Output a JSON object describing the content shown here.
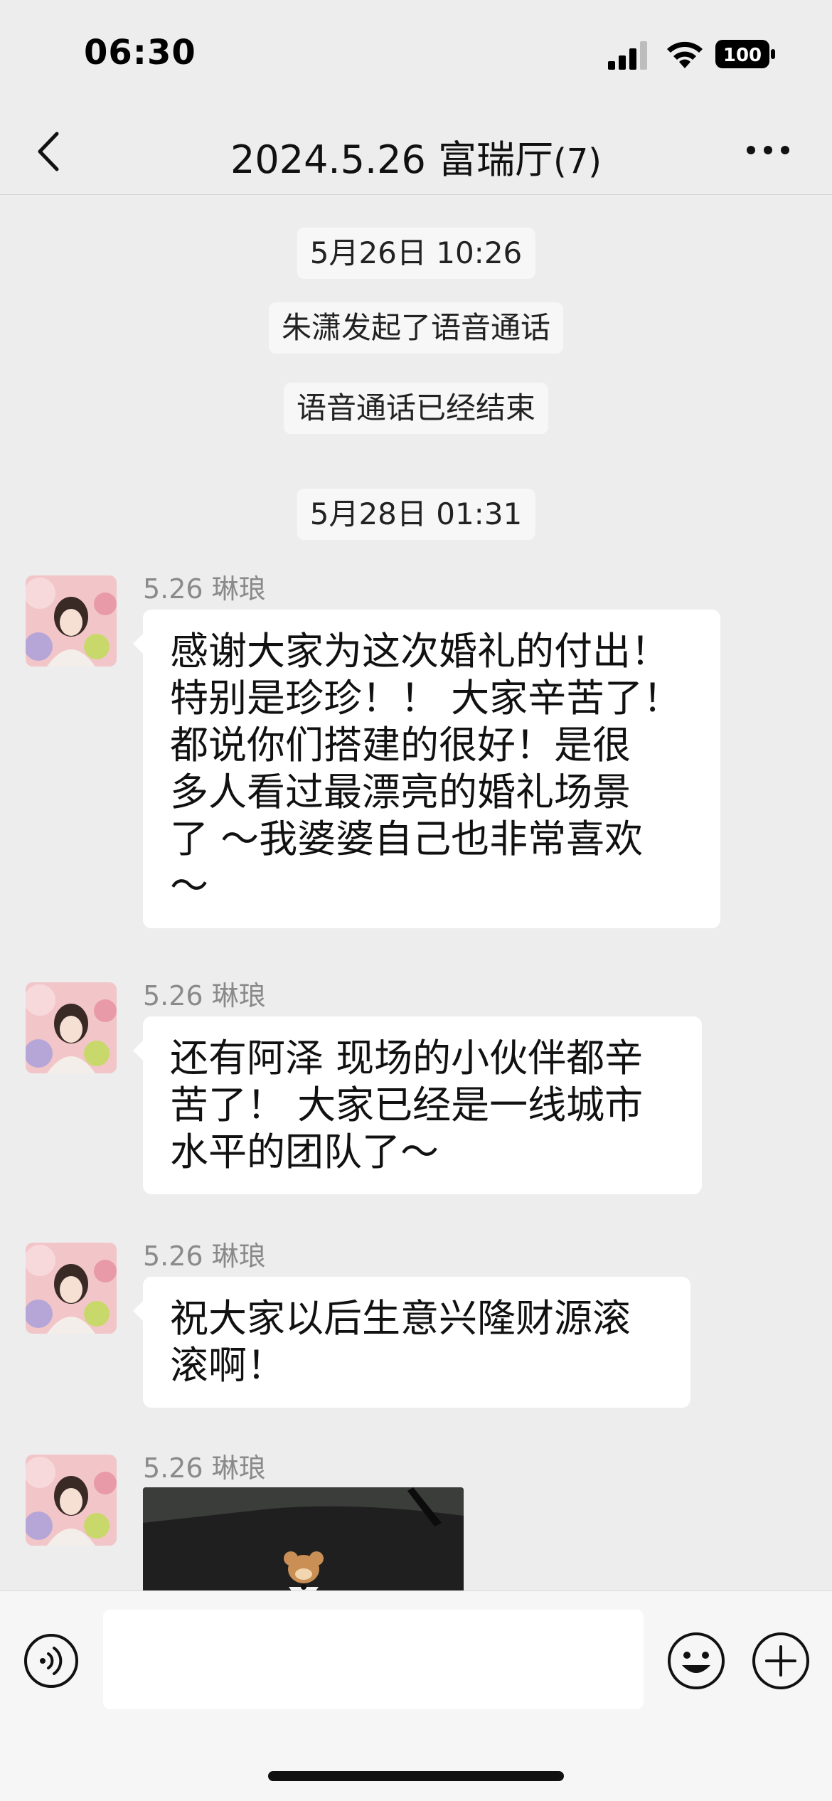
{
  "status_bar": {
    "time": "06:30",
    "battery": "100"
  },
  "nav": {
    "title": "2024.5.26 富瑞厅",
    "member_count": "(7)"
  },
  "system_messages": [
    {
      "text": "5月26日 10:26"
    },
    {
      "text": "朱潇发起了语音通话"
    },
    {
      "text": "语音通话已经结束"
    },
    {
      "text": "5月28日 01:31"
    }
  ],
  "messages": [
    {
      "sender": "5.26 琳琅",
      "text": "感谢大家为这次婚礼的付出！\n特别是珍珍！！ 大家辛苦了！\n都说你们搭建的很好！是很\n多人看过最漂亮的婚礼场景\n了 ～我婆婆自己也非常喜欢\n～"
    },
    {
      "sender": "5.26 琳琅",
      "text": "还有阿泽 现场的小伙伴都辛\n苦了！ 大家已经是一线城市\n水平的团队了～"
    },
    {
      "sender": "5.26 琳琅",
      "text": "祝大家以后生意兴隆财源滚\n滚啊！"
    },
    {
      "sender": "5.26 琳琅",
      "media": "image"
    }
  ],
  "input": {
    "placeholder": ""
  },
  "colors": {
    "background": "#ededed",
    "bubble": "#ffffff",
    "sender": "#8a8a8a"
  }
}
